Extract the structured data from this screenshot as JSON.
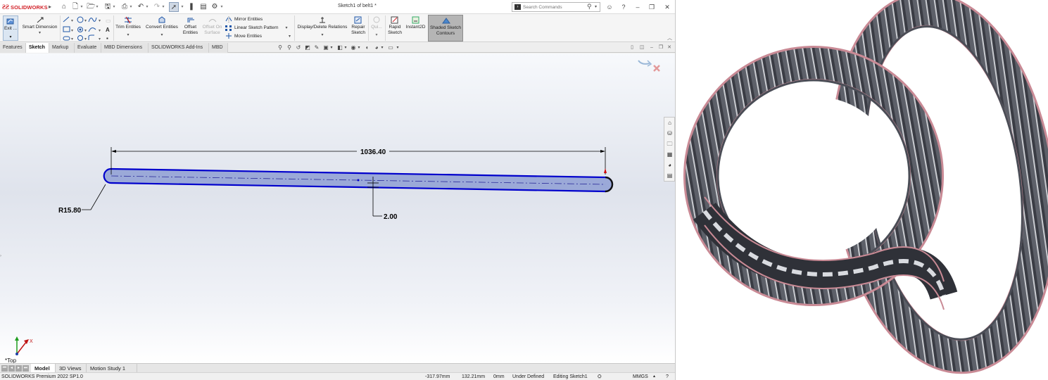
{
  "app": {
    "logo_text": "SOLIDWORKS",
    "document_title": "Sketch1 of belt1 *"
  },
  "search": {
    "placeholder": "Search Commands"
  },
  "ribbon": {
    "exit_label": "Exit ...",
    "smart_dimension": "Smart Dimension",
    "trim_entities": "Trim Entities",
    "convert_entities": "Convert Entities",
    "offset_entities": "Offset Entities",
    "offset_on_surface": "Offset On Surface",
    "mirror_entities": "Mirror Entities",
    "linear_sketch_pattern": "Linear Sketch Pattern",
    "move_entities": "Move Entities",
    "display_delete_relations": "Display/Delete Relations",
    "repair_sketch": "Repair Sketch",
    "quick_snaps": "Qui...",
    "rapid_sketch": "Rapid Sketch",
    "instant2d": "Instant2D",
    "shaded_sketch_contours": "Shaded Sketch Contours"
  },
  "tabs": [
    "Features",
    "Sketch",
    "Markup",
    "Evaluate",
    "MBD Dimensions",
    "SOLIDWORKS Add-Ins",
    "MBD"
  ],
  "active_tab": "Sketch",
  "sketch": {
    "dim_length": "1036.40",
    "dim_radius": "R15.80",
    "dim_offset": "2.00",
    "view_name": "*Top",
    "axis_x": "X",
    "slot_color": "#0000cc",
    "slot_fill": "#9ba9d8",
    "dimension_color": "#000000"
  },
  "bottom_tabs": [
    "Model",
    "3D Views",
    "Motion Study 1"
  ],
  "active_bottom_tab": "Model",
  "status": {
    "product": "SOLIDWORKS Premium 2022 SP1.0",
    "x_coord": "-317.97mm",
    "y_coord": "132.21mm",
    "z_coord": "0mm",
    "state": "Under Defined",
    "editing": "Editing Sketch1",
    "units": "MMGS"
  },
  "belt_image": {
    "description_color_body": "#3a3c44",
    "description_color_edge": "#c98a95"
  }
}
